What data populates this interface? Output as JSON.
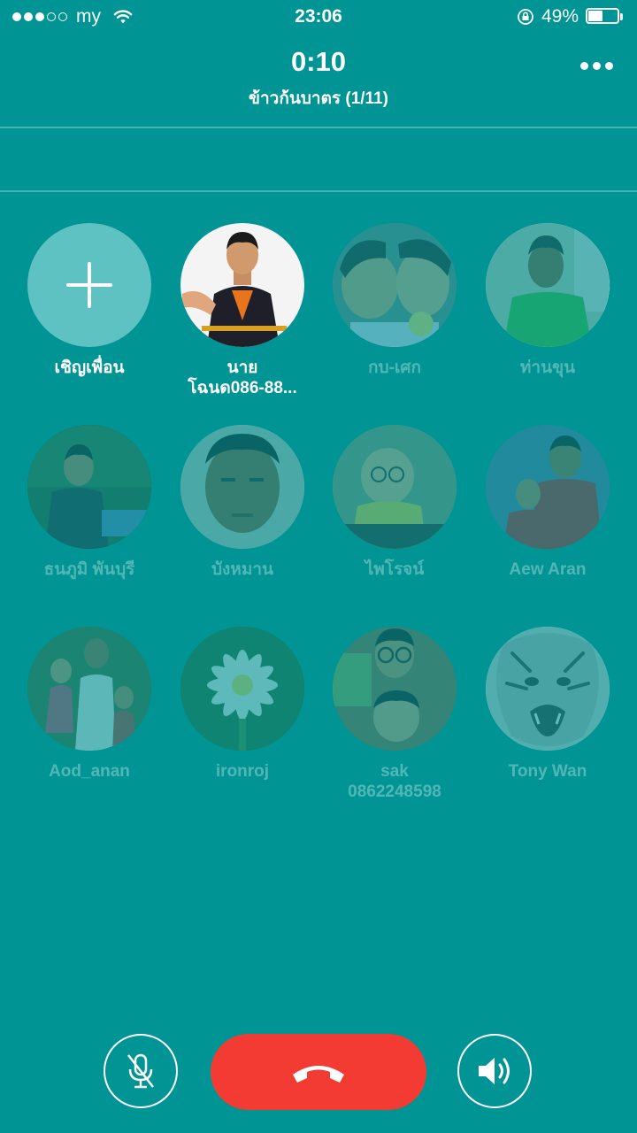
{
  "status_bar": {
    "carrier": "my",
    "time": "23:06",
    "battery_text": "49%",
    "battery_level": 0.49,
    "signal_full_dots": 3,
    "signal_total_dots": 5
  },
  "call": {
    "timer": "0:10",
    "group_title": "ข้าวก้นบาตร (1/11)"
  },
  "invite": {
    "label": "เชิญเพื่อน",
    "icon": "plus-icon"
  },
  "participants": [
    {
      "name_line1": "นาย",
      "name_line2": "โฉนด086-88...",
      "active": true
    },
    {
      "name_line1": "กบ-เศก",
      "active": false
    },
    {
      "name_line1": "ท่านขุน",
      "active": false
    },
    {
      "name_line1": "ธนภูมิ พันบุรี",
      "active": false
    },
    {
      "name_line1": "บังหมาน",
      "active": false
    },
    {
      "name_line1": "ไพโรจน์",
      "active": false
    },
    {
      "name_line1": "Aew  Aran",
      "active": false
    },
    {
      "name_line1": "Aod_anan",
      "active": false
    },
    {
      "name_line1": "ironroj",
      "active": false
    },
    {
      "name_line1": "sak",
      "name_line2": "0862248598",
      "active": false
    },
    {
      "name_line1": "Tony Wan",
      "active": false
    }
  ],
  "controls": {
    "mute_icon": "microphone-muted-icon",
    "end_call_icon": "phone-hangup-icon",
    "speaker_icon": "speaker-icon"
  },
  "colors": {
    "background": "#009494",
    "end_call": "#f43b33",
    "invite_circle": "#5ec2c2"
  }
}
